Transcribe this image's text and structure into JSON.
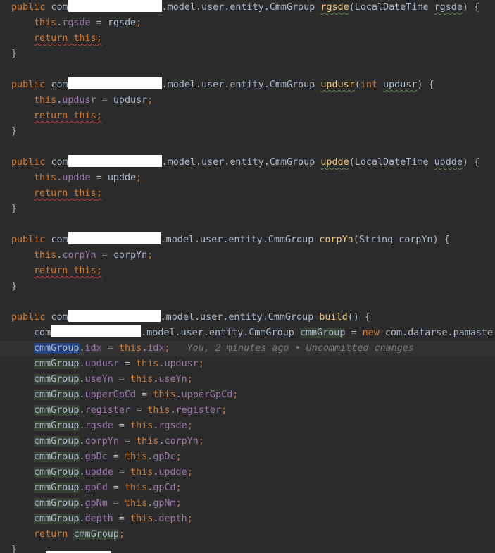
{
  "keywords": {
    "public": "public",
    "return": "return",
    "this": "this",
    "new": "new",
    "int": "int"
  },
  "types": {
    "pkg_prefix": "com",
    "pkg_suffix": ".model.user.entity.CmmGroup",
    "local_date_time": "LocalDateTime",
    "string": "String",
    "cmm_group_var": "cmmGroup",
    "new_pkg_tail": "com.datarse.pamaste"
  },
  "methods": {
    "rgsde": {
      "name": "rgsde",
      "param": "rgsde",
      "field": "rgsde"
    },
    "updusr": {
      "name": "updusr",
      "param": "updusr",
      "field": "updusr"
    },
    "updde": {
      "name": "updde",
      "param": "updde",
      "field": "updde"
    },
    "corpYn": {
      "name": "corpYn",
      "param": "corpYn",
      "field": "corpYn"
    },
    "build": {
      "name": "build"
    }
  },
  "build_fields": [
    "idx",
    "updusr",
    "useYn",
    "upperGpCd",
    "register",
    "rgsde",
    "corpYn",
    "gpDc",
    "updde",
    "gpCd",
    "gpNm",
    "depth"
  ],
  "blame": {
    "text": "You, 2 minutes ago • Uncommitted changes"
  },
  "punct": {
    "open_sig": "(",
    "close_sig": ") {",
    "empty_sig": "() {",
    "close_brace": "}",
    "assign": " = ",
    "semi": ";",
    "dot": ".",
    "return_this_semi": ";"
  }
}
